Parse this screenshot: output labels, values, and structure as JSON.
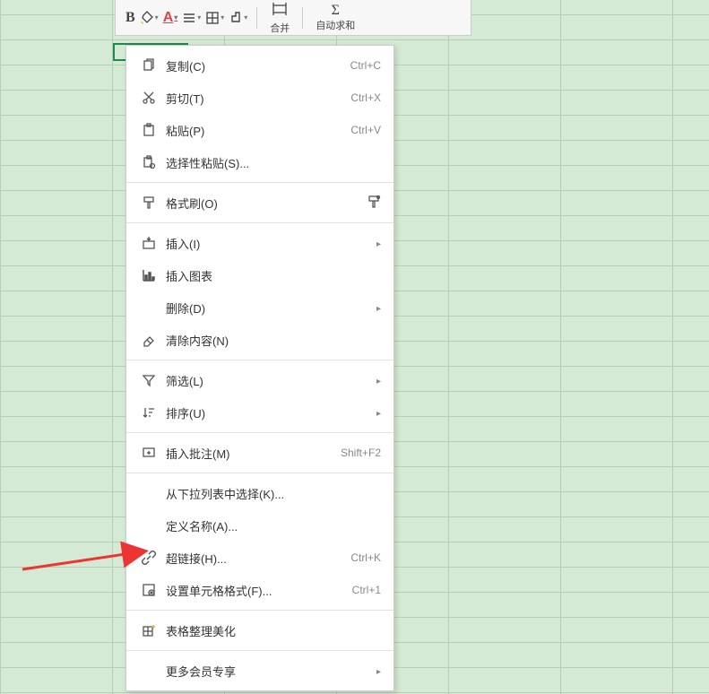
{
  "toolbar": {
    "merge_label": "合并",
    "autosum_label": "自动求和"
  },
  "menu": {
    "copy": {
      "label": "复制(C)",
      "shortcut": "Ctrl+C"
    },
    "cut": {
      "label": "剪切(T)",
      "shortcut": "Ctrl+X"
    },
    "paste": {
      "label": "粘贴(P)",
      "shortcut": "Ctrl+V"
    },
    "paste_special": {
      "label": "选择性粘贴(S)..."
    },
    "format_painter": {
      "label": "格式刷(O)"
    },
    "insert": {
      "label": "插入(I)"
    },
    "insert_chart": {
      "label": "插入图表"
    },
    "delete": {
      "label": "删除(D)"
    },
    "clear_contents": {
      "label": "清除内容(N)"
    },
    "filter": {
      "label": "筛选(L)"
    },
    "sort": {
      "label": "排序(U)"
    },
    "insert_comment": {
      "label": "插入批注(M)",
      "shortcut": "Shift+F2"
    },
    "pick_from_list": {
      "label": "从下拉列表中选择(K)..."
    },
    "define_name": {
      "label": "定义名称(A)..."
    },
    "hyperlink": {
      "label": "超链接(H)...",
      "shortcut": "Ctrl+K"
    },
    "format_cells": {
      "label": "设置单元格格式(F)...",
      "shortcut": "Ctrl+1"
    },
    "table_beautify": {
      "label": "表格整理美化"
    },
    "more_vip": {
      "label": "更多会员专享"
    }
  }
}
